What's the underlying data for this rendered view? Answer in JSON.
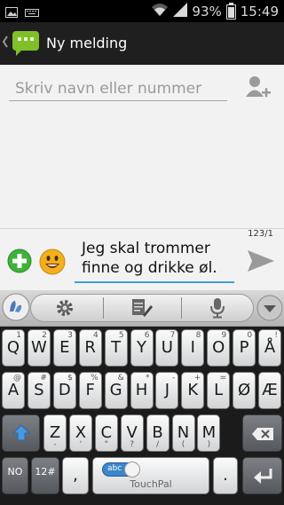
{
  "status_bar": {
    "battery": "93%",
    "time": "15:49",
    "left_icons": [
      "image-icon",
      "keyboard-icon"
    ],
    "right_icons": [
      "wifi-icon",
      "signal-icon",
      "battery-icon"
    ]
  },
  "action_bar": {
    "title": "Ny melding",
    "icon": "messaging-app-icon"
  },
  "recipient": {
    "placeholder": "Skriv navn eller nummer"
  },
  "compose": {
    "counter": "123/1",
    "message": "Jeg skal trommer finne og drikke øl."
  },
  "keyboard": {
    "row1": [
      {
        "main": "Q",
        "sub": "1"
      },
      {
        "main": "W",
        "sub": "2"
      },
      {
        "main": "E",
        "sub": "3"
      },
      {
        "main": "R",
        "sub": "4"
      },
      {
        "main": "T",
        "sub": "5"
      },
      {
        "main": "Y",
        "sub": "6"
      },
      {
        "main": "U",
        "sub": "7"
      },
      {
        "main": "I",
        "sub": "8"
      },
      {
        "main": "O",
        "sub": "9"
      },
      {
        "main": "P",
        "sub": "0"
      },
      {
        "main": "Å",
        "sub": "!"
      }
    ],
    "row2": [
      {
        "main": "A",
        "sub": "@"
      },
      {
        "main": "S",
        "sub": "#"
      },
      {
        "main": "D",
        "sub": "$"
      },
      {
        "main": "F",
        "sub": "%"
      },
      {
        "main": "G",
        "sub": "&"
      },
      {
        "main": "H",
        "sub": "*"
      },
      {
        "main": "J",
        "sub": "-"
      },
      {
        "main": "K",
        "sub": "+"
      },
      {
        "main": "L",
        "sub": "="
      },
      {
        "main": "Ø",
        "sub": ""
      },
      {
        "main": "Æ",
        "sub": ""
      }
    ],
    "row3": [
      {
        "main": "Z",
        "sub2": "-"
      },
      {
        "main": "X",
        "sub2": "'"
      },
      {
        "main": "C",
        "sub2": "\""
      },
      {
        "main": "V",
        "sub2": "?"
      },
      {
        "main": "B",
        "sub2": "/"
      },
      {
        "main": "N",
        "sub2": "("
      },
      {
        "main": "M",
        "sub2": ")"
      }
    ],
    "no_key": "NO",
    "num_key": "12#",
    "space_toggle": "abc",
    "space_label": "TouchPal",
    "comma_key": ",",
    "period_key": "."
  },
  "colors": {
    "accent": "#3aa0d6",
    "add_green": "#3fb23a",
    "send_gray": "#9a9a9a",
    "shift_blue": "#3c86c9"
  }
}
